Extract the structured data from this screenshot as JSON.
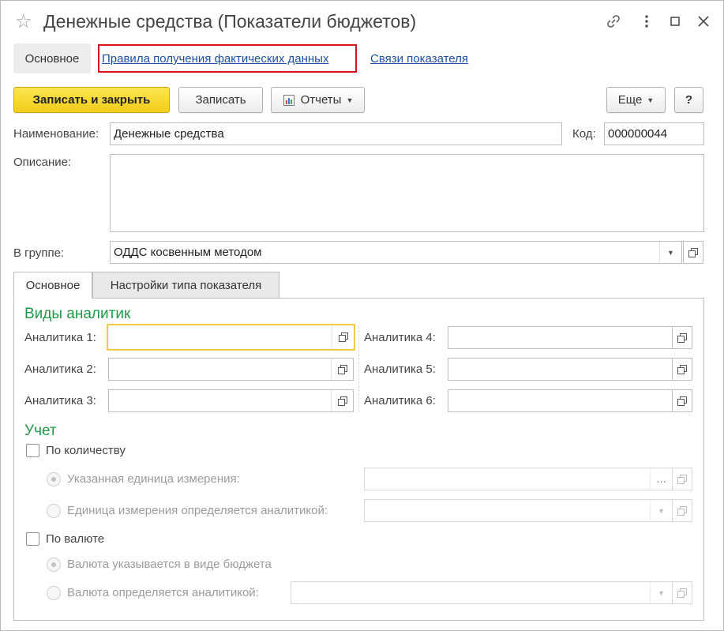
{
  "window": {
    "title": "Денежные средства (Показатели бюджетов)"
  },
  "nav": {
    "main": "Основное",
    "links": [
      "Правила получения фактических данных",
      "Связи показателя"
    ]
  },
  "toolbar": {
    "save_close": "Записать и закрыть",
    "save": "Записать",
    "reports": "Отчеты",
    "more": "Еще",
    "help": "?"
  },
  "form": {
    "name_label": "Наименование:",
    "name_value": "Денежные средства",
    "code_label": "Код:",
    "code_value": "000000044",
    "description_label": "Описание:",
    "description_value": "",
    "group_label": "В группе:",
    "group_value": "ОДДС косвенным методом"
  },
  "tabs": [
    "Основное",
    "Настройки типа показателя"
  ],
  "analytics": {
    "title": "Виды аналитик",
    "labels": [
      "Аналитика 1:",
      "Аналитика 2:",
      "Аналитика 3:",
      "Аналитика 4:",
      "Аналитика 5:",
      "Аналитика 6:"
    ]
  },
  "accounting": {
    "title": "Учет",
    "by_quantity": "По количеству",
    "unit_specified": "Указанная единица измерения:",
    "unit_by_analytics": "Единица измерения определяется аналитикой:",
    "by_currency": "По валюте",
    "currency_in_budget_type": "Валюта указывается в виде бюджета",
    "currency_by_analytics": "Валюта определяется аналитикой:"
  },
  "colors": {
    "primary_button": "#f3cc1a",
    "link": "#1c4fa7",
    "section_title": "#1f9a46",
    "highlight_border": "#d9131b",
    "focus_border": "#f0c22e"
  }
}
